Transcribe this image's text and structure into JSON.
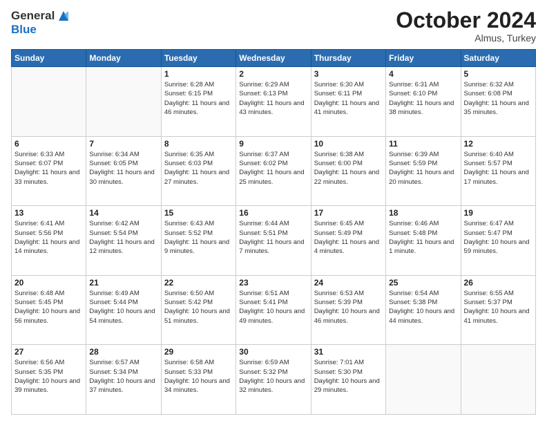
{
  "header": {
    "logo_general": "General",
    "logo_blue": "Blue",
    "month": "October 2024",
    "location": "Almus, Turkey"
  },
  "days_of_week": [
    "Sunday",
    "Monday",
    "Tuesday",
    "Wednesday",
    "Thursday",
    "Friday",
    "Saturday"
  ],
  "weeks": [
    [
      {
        "day": "",
        "info": ""
      },
      {
        "day": "",
        "info": ""
      },
      {
        "day": "1",
        "info": "Sunrise: 6:28 AM\nSunset: 6:15 PM\nDaylight: 11 hours and 46 minutes."
      },
      {
        "day": "2",
        "info": "Sunrise: 6:29 AM\nSunset: 6:13 PM\nDaylight: 11 hours and 43 minutes."
      },
      {
        "day": "3",
        "info": "Sunrise: 6:30 AM\nSunset: 6:11 PM\nDaylight: 11 hours and 41 minutes."
      },
      {
        "day": "4",
        "info": "Sunrise: 6:31 AM\nSunset: 6:10 PM\nDaylight: 11 hours and 38 minutes."
      },
      {
        "day": "5",
        "info": "Sunrise: 6:32 AM\nSunset: 6:08 PM\nDaylight: 11 hours and 35 minutes."
      }
    ],
    [
      {
        "day": "6",
        "info": "Sunrise: 6:33 AM\nSunset: 6:07 PM\nDaylight: 11 hours and 33 minutes."
      },
      {
        "day": "7",
        "info": "Sunrise: 6:34 AM\nSunset: 6:05 PM\nDaylight: 11 hours and 30 minutes."
      },
      {
        "day": "8",
        "info": "Sunrise: 6:35 AM\nSunset: 6:03 PM\nDaylight: 11 hours and 27 minutes."
      },
      {
        "day": "9",
        "info": "Sunrise: 6:37 AM\nSunset: 6:02 PM\nDaylight: 11 hours and 25 minutes."
      },
      {
        "day": "10",
        "info": "Sunrise: 6:38 AM\nSunset: 6:00 PM\nDaylight: 11 hours and 22 minutes."
      },
      {
        "day": "11",
        "info": "Sunrise: 6:39 AM\nSunset: 5:59 PM\nDaylight: 11 hours and 20 minutes."
      },
      {
        "day": "12",
        "info": "Sunrise: 6:40 AM\nSunset: 5:57 PM\nDaylight: 11 hours and 17 minutes."
      }
    ],
    [
      {
        "day": "13",
        "info": "Sunrise: 6:41 AM\nSunset: 5:56 PM\nDaylight: 11 hours and 14 minutes."
      },
      {
        "day": "14",
        "info": "Sunrise: 6:42 AM\nSunset: 5:54 PM\nDaylight: 11 hours and 12 minutes."
      },
      {
        "day": "15",
        "info": "Sunrise: 6:43 AM\nSunset: 5:52 PM\nDaylight: 11 hours and 9 minutes."
      },
      {
        "day": "16",
        "info": "Sunrise: 6:44 AM\nSunset: 5:51 PM\nDaylight: 11 hours and 7 minutes."
      },
      {
        "day": "17",
        "info": "Sunrise: 6:45 AM\nSunset: 5:49 PM\nDaylight: 11 hours and 4 minutes."
      },
      {
        "day": "18",
        "info": "Sunrise: 6:46 AM\nSunset: 5:48 PM\nDaylight: 11 hours and 1 minute."
      },
      {
        "day": "19",
        "info": "Sunrise: 6:47 AM\nSunset: 5:47 PM\nDaylight: 10 hours and 59 minutes."
      }
    ],
    [
      {
        "day": "20",
        "info": "Sunrise: 6:48 AM\nSunset: 5:45 PM\nDaylight: 10 hours and 56 minutes."
      },
      {
        "day": "21",
        "info": "Sunrise: 6:49 AM\nSunset: 5:44 PM\nDaylight: 10 hours and 54 minutes."
      },
      {
        "day": "22",
        "info": "Sunrise: 6:50 AM\nSunset: 5:42 PM\nDaylight: 10 hours and 51 minutes."
      },
      {
        "day": "23",
        "info": "Sunrise: 6:51 AM\nSunset: 5:41 PM\nDaylight: 10 hours and 49 minutes."
      },
      {
        "day": "24",
        "info": "Sunrise: 6:53 AM\nSunset: 5:39 PM\nDaylight: 10 hours and 46 minutes."
      },
      {
        "day": "25",
        "info": "Sunrise: 6:54 AM\nSunset: 5:38 PM\nDaylight: 10 hours and 44 minutes."
      },
      {
        "day": "26",
        "info": "Sunrise: 6:55 AM\nSunset: 5:37 PM\nDaylight: 10 hours and 41 minutes."
      }
    ],
    [
      {
        "day": "27",
        "info": "Sunrise: 6:56 AM\nSunset: 5:35 PM\nDaylight: 10 hours and 39 minutes."
      },
      {
        "day": "28",
        "info": "Sunrise: 6:57 AM\nSunset: 5:34 PM\nDaylight: 10 hours and 37 minutes."
      },
      {
        "day": "29",
        "info": "Sunrise: 6:58 AM\nSunset: 5:33 PM\nDaylight: 10 hours and 34 minutes."
      },
      {
        "day": "30",
        "info": "Sunrise: 6:59 AM\nSunset: 5:32 PM\nDaylight: 10 hours and 32 minutes."
      },
      {
        "day": "31",
        "info": "Sunrise: 7:01 AM\nSunset: 5:30 PM\nDaylight: 10 hours and 29 minutes."
      },
      {
        "day": "",
        "info": ""
      },
      {
        "day": "",
        "info": ""
      }
    ]
  ]
}
